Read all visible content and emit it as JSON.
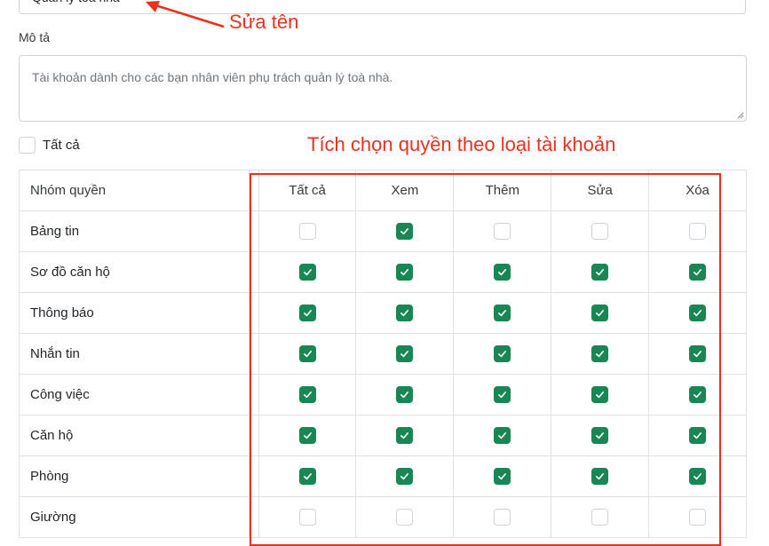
{
  "form": {
    "name_value": "Quản lý toà nhà",
    "description_label": "Mô tả",
    "description_placeholder": "Tài khoản dành cho các bạn nhân viên phụ trách quản lý toà nhà.",
    "select_all_label": "Tất cả"
  },
  "annotations": {
    "rename": "Sửa tên",
    "permissions": "Tích chọn quyền theo loại tài khoản",
    "color": "#e8321e"
  },
  "table": {
    "headers": [
      "Nhóm quyền",
      "Tất cả",
      "Xem",
      "Thêm",
      "Sửa",
      "Xóa"
    ],
    "rows": [
      {
        "name": "Bảng tin",
        "checks": [
          false,
          true,
          false,
          false,
          false
        ]
      },
      {
        "name": "Sơ đồ căn hộ",
        "checks": [
          true,
          true,
          true,
          true,
          true
        ]
      },
      {
        "name": "Thông báo",
        "checks": [
          true,
          true,
          true,
          true,
          true
        ]
      },
      {
        "name": "Nhắn tin",
        "checks": [
          true,
          true,
          true,
          true,
          true
        ]
      },
      {
        "name": "Công việc",
        "checks": [
          true,
          true,
          true,
          true,
          true
        ]
      },
      {
        "name": "Căn hộ",
        "checks": [
          true,
          true,
          true,
          true,
          true
        ]
      },
      {
        "name": "Phòng",
        "checks": [
          true,
          true,
          true,
          true,
          true
        ]
      },
      {
        "name": "Giường",
        "checks": [
          false,
          false,
          false,
          false,
          false
        ]
      }
    ]
  },
  "colors": {
    "checked": "#198754",
    "border": "#ced4da"
  }
}
